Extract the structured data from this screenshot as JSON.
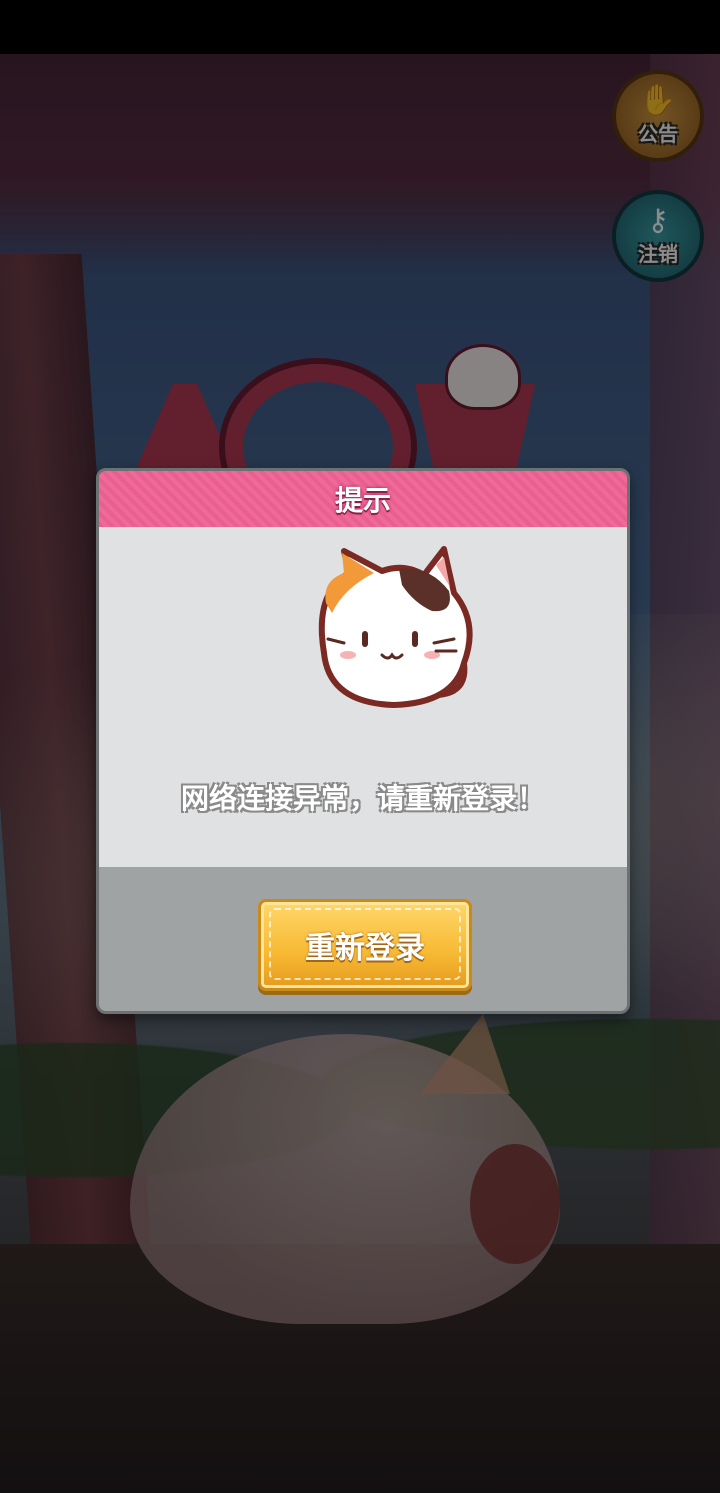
{
  "side_buttons": {
    "notice_label": "公告",
    "logout_label": "注销"
  },
  "dialog": {
    "title": "提示",
    "message": "网络连接异常，请重新登录！",
    "button_label": "重新登录"
  },
  "colors": {
    "header_pink": "#e95f8f",
    "button_gold": "#f7b933",
    "dialog_body": "#dfe1e3"
  }
}
